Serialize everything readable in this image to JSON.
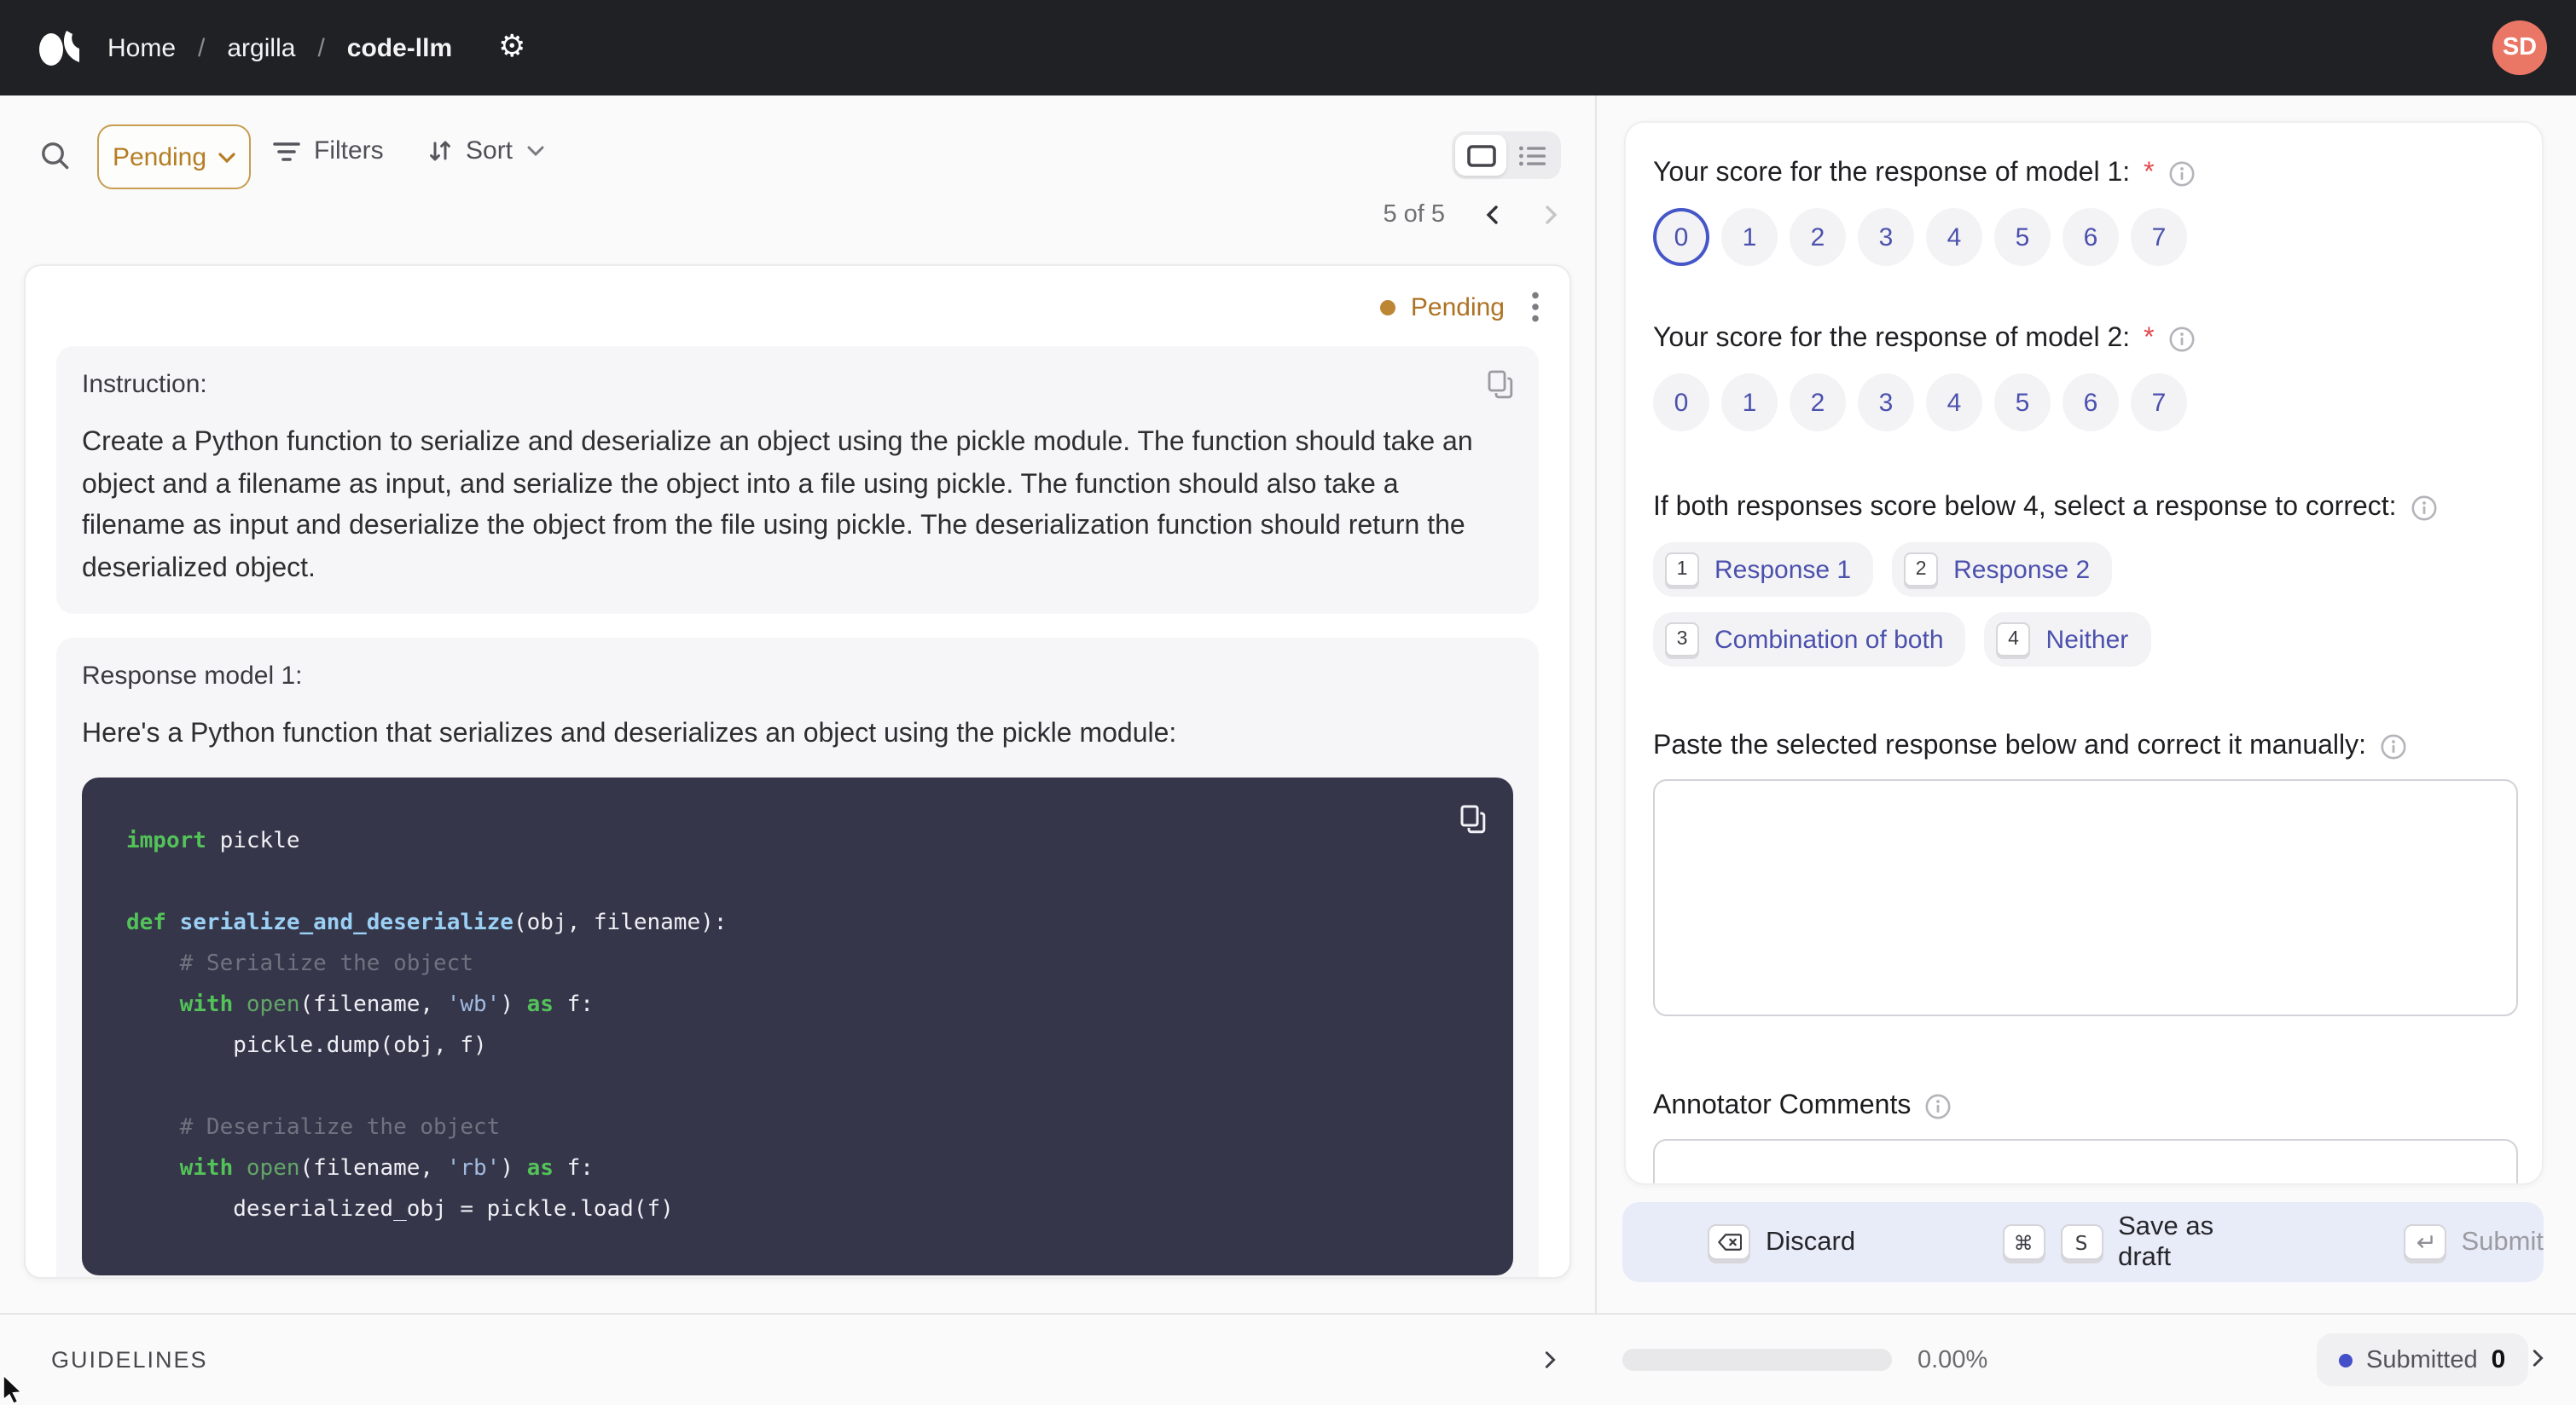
{
  "navbar": {
    "breadcrumb": {
      "home": "Home",
      "sep": "/",
      "workspace": "argilla",
      "dataset": "code-llm"
    },
    "settings_icon": "gear-icon",
    "avatar_initials": "SD"
  },
  "toolbar": {
    "status_filter": "Pending",
    "filters_label": "Filters",
    "sort_label": "Sort"
  },
  "pagination": {
    "count": "5 of 5"
  },
  "record": {
    "status": "Pending",
    "fields": [
      {
        "title": "Instruction:",
        "text": "Create a Python function to serialize and deserialize an object using the pickle module. The function should take an object and a filename as input, and serialize the object into a file using pickle. The function should also take a filename as input and deserialize the object from the file using pickle. The deserialization function should return the deserialized object."
      },
      {
        "title": "Response model 1:",
        "text": "Here's a Python function that serializes and deserializes an object using the pickle module:"
      }
    ],
    "code": {
      "lines": [
        [
          {
            "c": "kw",
            "t": "import"
          },
          {
            "c": "pl",
            "t": " pickle"
          }
        ],
        [],
        [
          {
            "c": "kw",
            "t": "def"
          },
          {
            "c": "pl",
            "t": " "
          },
          {
            "c": "fn",
            "t": "serialize_and_deserialize"
          },
          {
            "c": "pl",
            "t": "(obj, filename):"
          }
        ],
        [
          {
            "c": "cm",
            "t": "    # Serialize the object"
          }
        ],
        [
          {
            "c": "pl",
            "t": "    "
          },
          {
            "c": "kw",
            "t": "with"
          },
          {
            "c": "pl",
            "t": " "
          },
          {
            "c": "bi",
            "t": "open"
          },
          {
            "c": "pl",
            "t": "(filename, "
          },
          {
            "c": "st",
            "t": "'wb'"
          },
          {
            "c": "pl",
            "t": ") "
          },
          {
            "c": "kw",
            "t": "as"
          },
          {
            "c": "pl",
            "t": " f:"
          }
        ],
        [
          {
            "c": "pl",
            "t": "        pickle.dump(obj, f)"
          }
        ],
        [],
        [
          {
            "c": "cm",
            "t": "    # Deserialize the object"
          }
        ],
        [
          {
            "c": "pl",
            "t": "    "
          },
          {
            "c": "kw",
            "t": "with"
          },
          {
            "c": "pl",
            "t": " "
          },
          {
            "c": "bi",
            "t": "open"
          },
          {
            "c": "pl",
            "t": "(filename, "
          },
          {
            "c": "st",
            "t": "'rb'"
          },
          {
            "c": "pl",
            "t": ") "
          },
          {
            "c": "kw",
            "t": "as"
          },
          {
            "c": "pl",
            "t": " f:"
          }
        ],
        [
          {
            "c": "pl",
            "t": "        deserialized_obj = pickle.load(f)"
          }
        ]
      ]
    }
  },
  "questions": {
    "q1": {
      "label": "Your score for the response of model 1:",
      "required": "*",
      "options": [
        "0",
        "1",
        "2",
        "3",
        "4",
        "5",
        "6",
        "7"
      ],
      "selected": "0"
    },
    "q2": {
      "label": "Your score for the response of model 2:",
      "required": "*",
      "options": [
        "0",
        "1",
        "2",
        "3",
        "4",
        "5",
        "6",
        "7"
      ],
      "selected": null
    },
    "q3": {
      "label": "If both responses score below 4, select a response to correct:",
      "options": [
        {
          "key": "1",
          "label": "Response 1"
        },
        {
          "key": "2",
          "label": "Response 2"
        },
        {
          "key": "3",
          "label": "Combination of both"
        },
        {
          "key": "4",
          "label": "Neither"
        }
      ]
    },
    "q4": {
      "label": "Paste the selected response below and correct it manually:",
      "value": "",
      "placeholder": ""
    },
    "q5": {
      "label": "Annotator Comments",
      "value": "",
      "placeholder": ""
    }
  },
  "actions": {
    "discard": "Discard",
    "save": "Save as draft",
    "submit": "Submit",
    "keys": {
      "discard": "backspace",
      "save_mod": "⌘",
      "save_key": "S",
      "submit": "return"
    }
  },
  "footer": {
    "guidelines": "GUIDELINES",
    "progress_pct": "0.00%",
    "submitted_label": "Submitted",
    "submitted_count": "0"
  },
  "colors": {
    "navbar_bg": "#202125",
    "pending": "#b57d24",
    "avatar_bg": "#ea7766",
    "rating_text": "#4b51ad",
    "rating_selected_ring": "#4556c8",
    "required": "#e5484d",
    "code_bg": "#35364a",
    "code_keyword": "#53c258",
    "code_function": "#9bd0f5",
    "code_string": "#a2bbdf",
    "code_comment": "#70737f",
    "action_bar_bg": "#e8ecf8",
    "submitted_dot": "#4350c8"
  }
}
